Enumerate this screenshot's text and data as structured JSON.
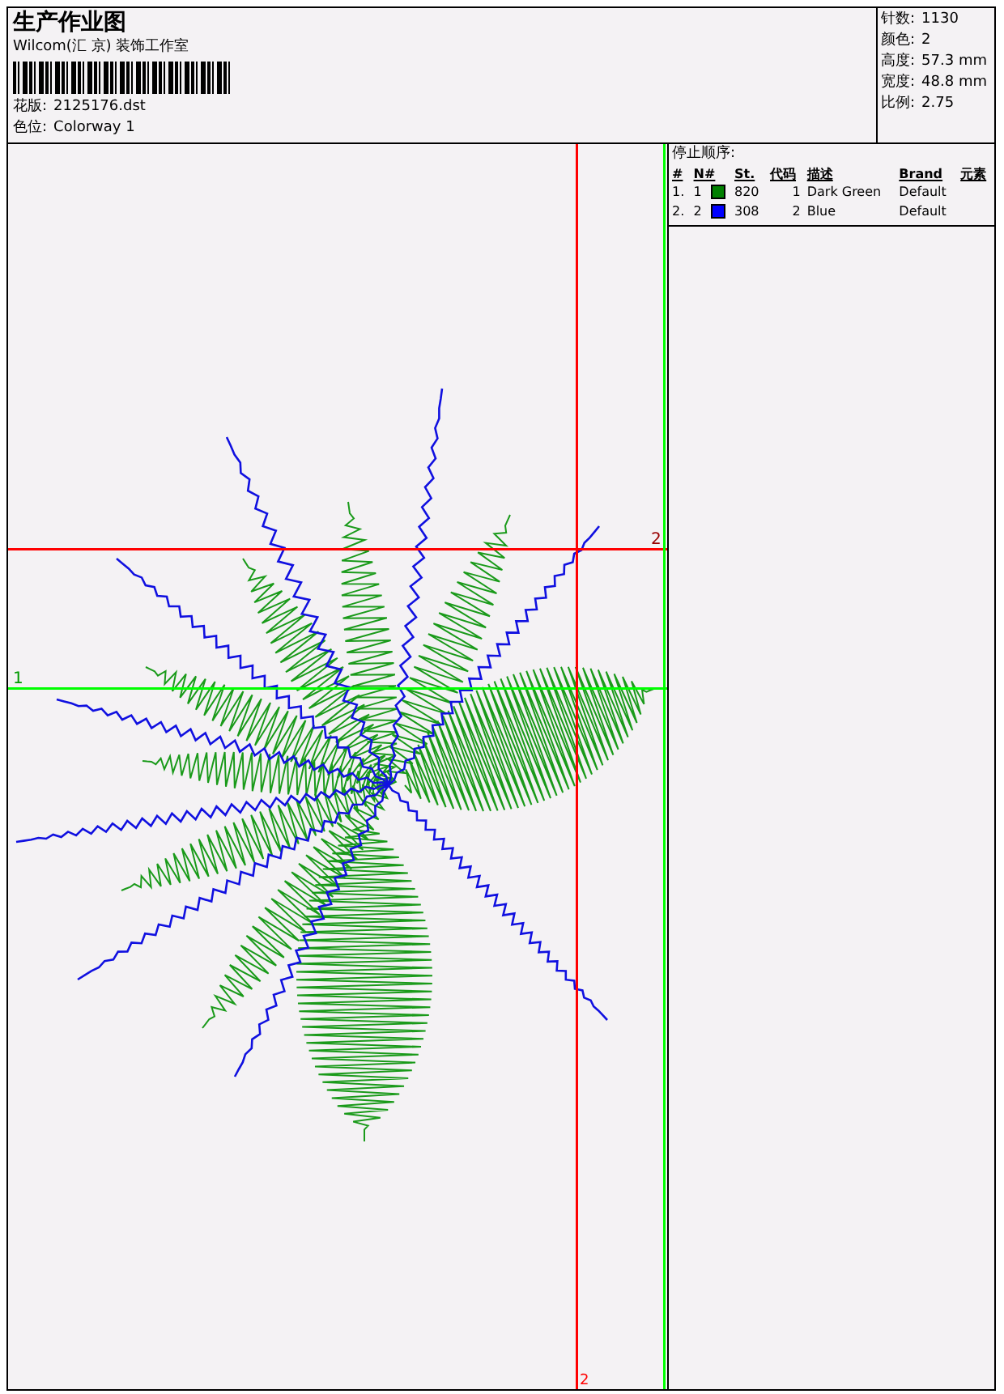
{
  "header": {
    "title": "生产作业图",
    "company": "Wilcom(汇 京) 装饰工作室",
    "design_file": {
      "label": "花版:",
      "value": "2125176.dst"
    },
    "colorway": {
      "label": "色位:",
      "value": "Colorway 1"
    }
  },
  "stats": [
    {
      "label": "针数:",
      "value": "1130"
    },
    {
      "label": "颜色:",
      "value": "2"
    },
    {
      "label": "高度:",
      "value": "57.3 mm"
    },
    {
      "label": "宽度:",
      "value": "48.8 mm"
    },
    {
      "label": "比例:",
      "value": "2.75"
    }
  ],
  "stop_sequence": {
    "title": "停止顺序:",
    "columns": [
      "#",
      "N#",
      "St.",
      "代码",
      "描述",
      "Brand",
      "元素"
    ],
    "rows": [
      {
        "index": "1.",
        "n": "1",
        "color": "#008000",
        "st": "820",
        "code": "1",
        "description": "Dark Green",
        "brand": "Default"
      },
      {
        "index": "2.",
        "n": "2",
        "color": "#0000ff",
        "st": "308",
        "code": "2",
        "description": "Blue",
        "brand": "Default"
      }
    ]
  },
  "guides": [
    {
      "kind": "horizontal",
      "label": "1",
      "color": "#00ff00"
    },
    {
      "kind": "horizontal",
      "label": "2",
      "color": "#ff0000"
    },
    {
      "kind": "vertical",
      "label": "2",
      "color": "#ff0000"
    },
    {
      "kind": "vertical",
      "color": "#00ff00"
    }
  ]
}
